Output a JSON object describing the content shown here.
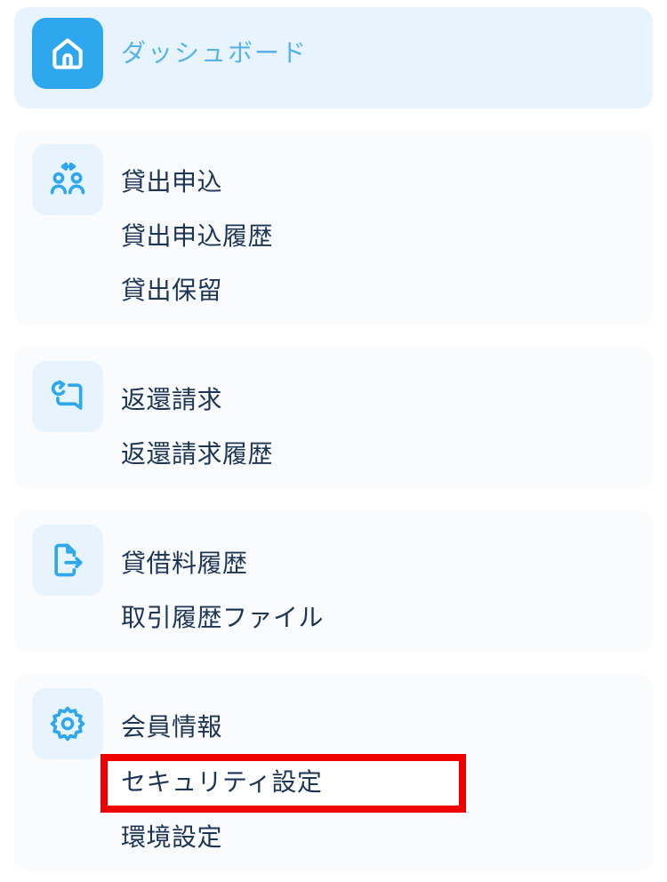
{
  "menu": {
    "dashboard": {
      "icon": "home-icon",
      "label": "ダッシュボード"
    },
    "loan": {
      "icon": "people-exchange-icon",
      "items": [
        "貸出申込",
        "貸出申込履歴",
        "貸出保留"
      ]
    },
    "return": {
      "icon": "return-request-icon",
      "items": [
        "返還請求",
        "返還請求履歴"
      ]
    },
    "fee": {
      "icon": "file-export-icon",
      "items": [
        "貸借料履歴",
        "取引履歴ファイル"
      ]
    },
    "settings": {
      "icon": "gear-icon",
      "items": [
        "会員情報",
        "セキュリティ設定",
        "環境設定"
      ]
    }
  },
  "colors": {
    "accent": "#2ea7ee",
    "active_bg": "#e8f4fd",
    "active_label": "#55b3ea",
    "text": "#1c3557",
    "highlight": "#ee0000"
  }
}
